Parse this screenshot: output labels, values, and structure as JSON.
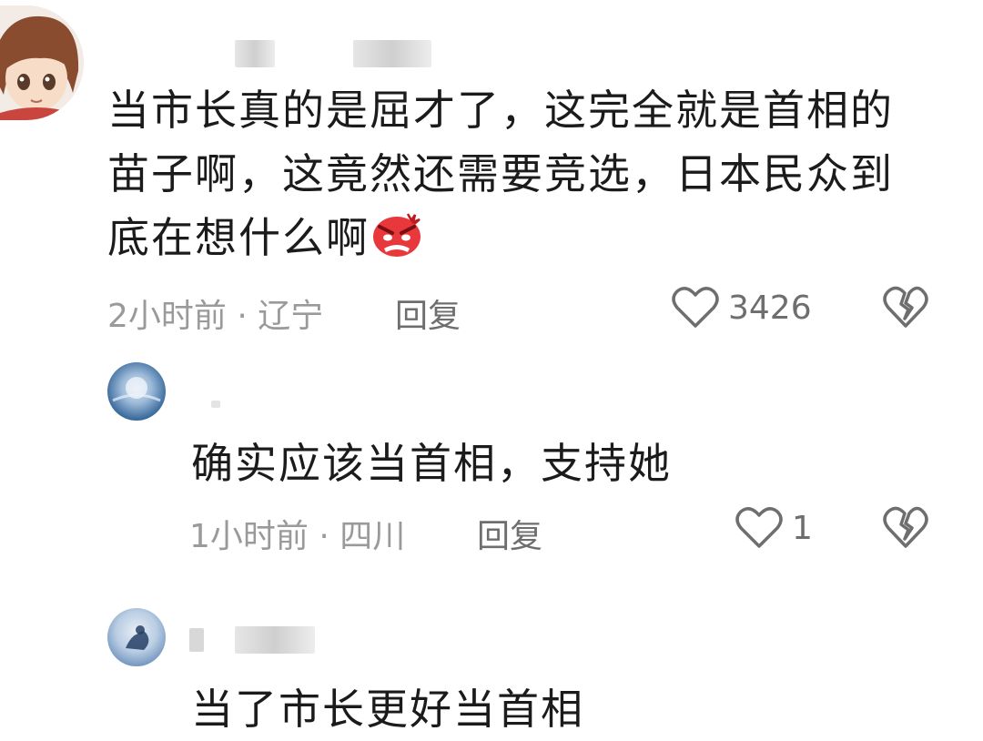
{
  "comments": [
    {
      "text_line1": "当市长真的是屈才了，这完全就是首相的",
      "text_line2": "苗子啊，这竟然还需要竞选，日本民众到",
      "text_line3": "底在想什么啊",
      "emoji": "angry-face-emoji",
      "time_location": "2小时前 · 辽宁",
      "reply_label": "回复",
      "likes": "3426"
    },
    {
      "text": "确实应该当首相，支持她",
      "time_location": "1小时前 · 四川",
      "reply_label": "回复",
      "likes": "1"
    },
    {
      "text": "当了市长更好当首相"
    }
  ],
  "colors": {
    "text": "#1b1b1b",
    "meta": "#9a9a9a",
    "icon": "#6e6e6e",
    "emoji": "#e8383b"
  }
}
